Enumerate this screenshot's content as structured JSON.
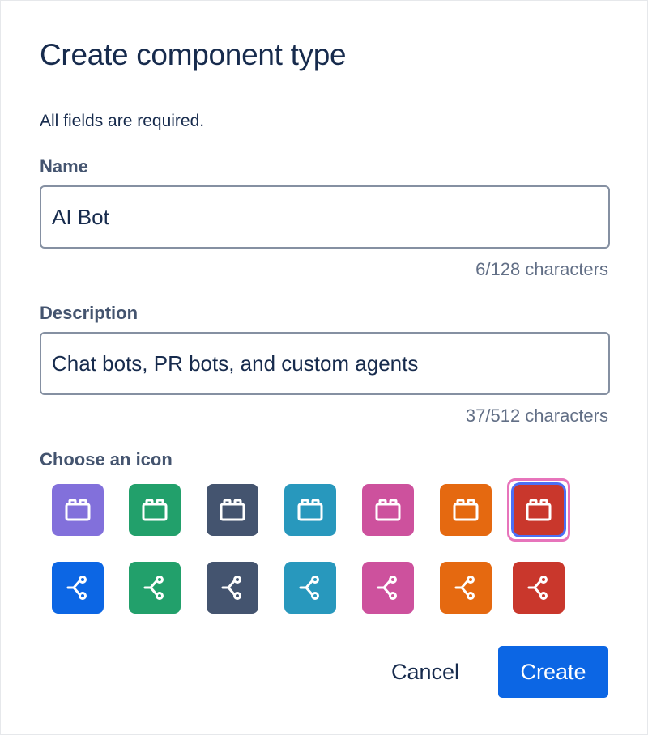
{
  "dialog": {
    "title": "Create component type",
    "required_note": "All fields are required."
  },
  "name_field": {
    "label": "Name",
    "value": "AI Bot",
    "char_count": "6/128 characters"
  },
  "description_field": {
    "label": "Description",
    "value": "Chat bots, PR bots, and custom agents",
    "char_count": "37/512 characters"
  },
  "icon_picker": {
    "label": "Choose an icon",
    "selected": "block-red",
    "rows": [
      {
        "shape": "block-icon",
        "colors": [
          "#8270db",
          "#22a06b",
          "#44546f",
          "#2898bd",
          "#cd519d",
          "#e56910",
          "#c9372c"
        ]
      },
      {
        "shape": "branch-icon",
        "colors": [
          "#0c66e4",
          "#22a06b",
          "#44546f",
          "#2898bd",
          "#cd519d",
          "#e56910",
          "#c9372c"
        ]
      }
    ]
  },
  "footer": {
    "cancel_label": "Cancel",
    "create_label": "Create"
  }
}
